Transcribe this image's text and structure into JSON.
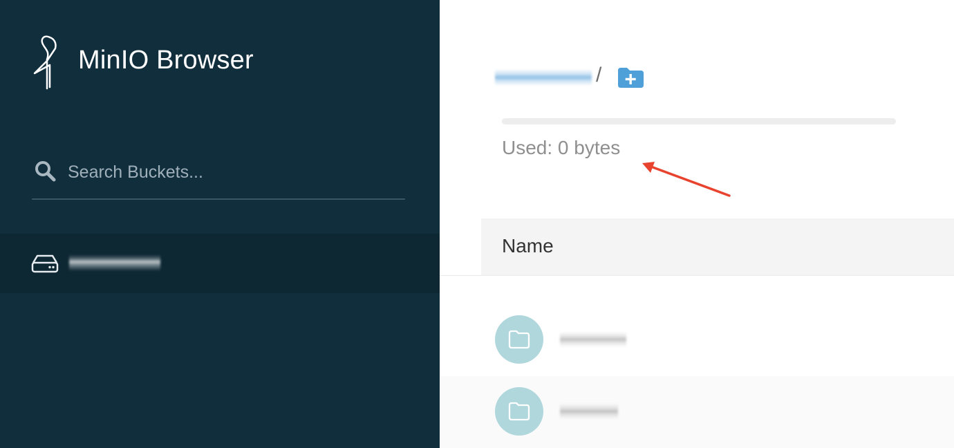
{
  "sidebar": {
    "app_title": "MinIO Browser",
    "search": {
      "placeholder": "Search Buckets...",
      "value": ""
    },
    "buckets": [
      {
        "name": "",
        "icon": "drive-icon",
        "selected": true
      }
    ]
  },
  "main": {
    "breadcrumb": {
      "bucket": "",
      "separator": "/",
      "add_folder_icon": "folder-plus-icon"
    },
    "usage": {
      "text": "Used: 0 bytes",
      "fraction": 0
    },
    "table": {
      "columns": [
        "Name"
      ],
      "rows": [
        {
          "name": "",
          "icon": "folder-icon"
        },
        {
          "name": "",
          "icon": "folder-icon"
        }
      ]
    }
  },
  "colors": {
    "sidebar_bg": "#112e3d",
    "selected_item_bg": "#0d2733",
    "folder_circle": "#afd7dc",
    "add_folder_blue": "#4f9fd9",
    "annotation_arrow": "#e8432e"
  }
}
